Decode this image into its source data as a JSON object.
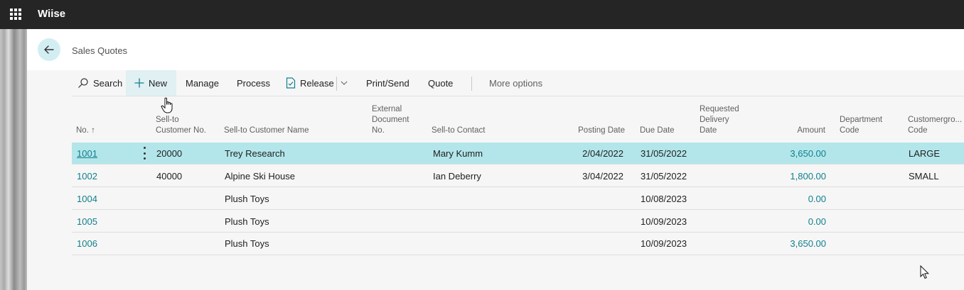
{
  "app": {
    "title": "Wiise",
    "waffle_icon": "waffle-icon"
  },
  "page": {
    "title": "Sales Quotes",
    "back_icon": "arrow-left-icon"
  },
  "actions": {
    "search": "Search",
    "new": "New",
    "manage": "Manage",
    "process": "Process",
    "release": "Release",
    "print_send": "Print/Send",
    "quote": "Quote",
    "more": "More options"
  },
  "columns": {
    "no": "No. ↑",
    "sell_to_no_1": "Sell-to",
    "sell_to_no_2": "Customer No.",
    "sell_to_name": "Sell-to Customer Name",
    "ext_doc_1": "External",
    "ext_doc_2": "Document",
    "ext_doc_3": "No.",
    "contact": "Sell-to Contact",
    "posting_date": "Posting Date",
    "due_date": "Due Date",
    "req_del_1": "Requested",
    "req_del_2": "Delivery",
    "req_del_3": "Date",
    "amount": "Amount",
    "dept_1": "Department",
    "dept_2": "Code",
    "custgrp_1": "Customergro...",
    "custgrp_2": "Code"
  },
  "rows": [
    {
      "no": "1001",
      "cust_no": "20000",
      "name": "Trey Research",
      "contact": "Mary Kumm",
      "posting_date": "2/04/2022",
      "due_date": "31/05/2022",
      "amount": "3,650.00",
      "group": "LARGE"
    },
    {
      "no": "1002",
      "cust_no": "40000",
      "name": "Alpine Ski House",
      "contact": "Ian Deberry",
      "posting_date": "3/04/2022",
      "due_date": "31/05/2022",
      "amount": "1,800.00",
      "group": "SMALL"
    },
    {
      "no": "1004",
      "cust_no": "",
      "name": "Plush Toys",
      "contact": "",
      "posting_date": "",
      "due_date": "10/08/2023",
      "amount": "0.00",
      "group": ""
    },
    {
      "no": "1005",
      "cust_no": "",
      "name": "Plush Toys",
      "contact": "",
      "posting_date": "",
      "due_date": "10/09/2023",
      "amount": "0.00",
      "group": ""
    },
    {
      "no": "1006",
      "cust_no": "",
      "name": "Plush Toys",
      "contact": "",
      "posting_date": "",
      "due_date": "10/09/2023",
      "amount": "3,650.00",
      "group": ""
    }
  ],
  "colors": {
    "accent": "#117f8c",
    "selected_row": "#b3e6ea",
    "topbar": "#252525"
  }
}
